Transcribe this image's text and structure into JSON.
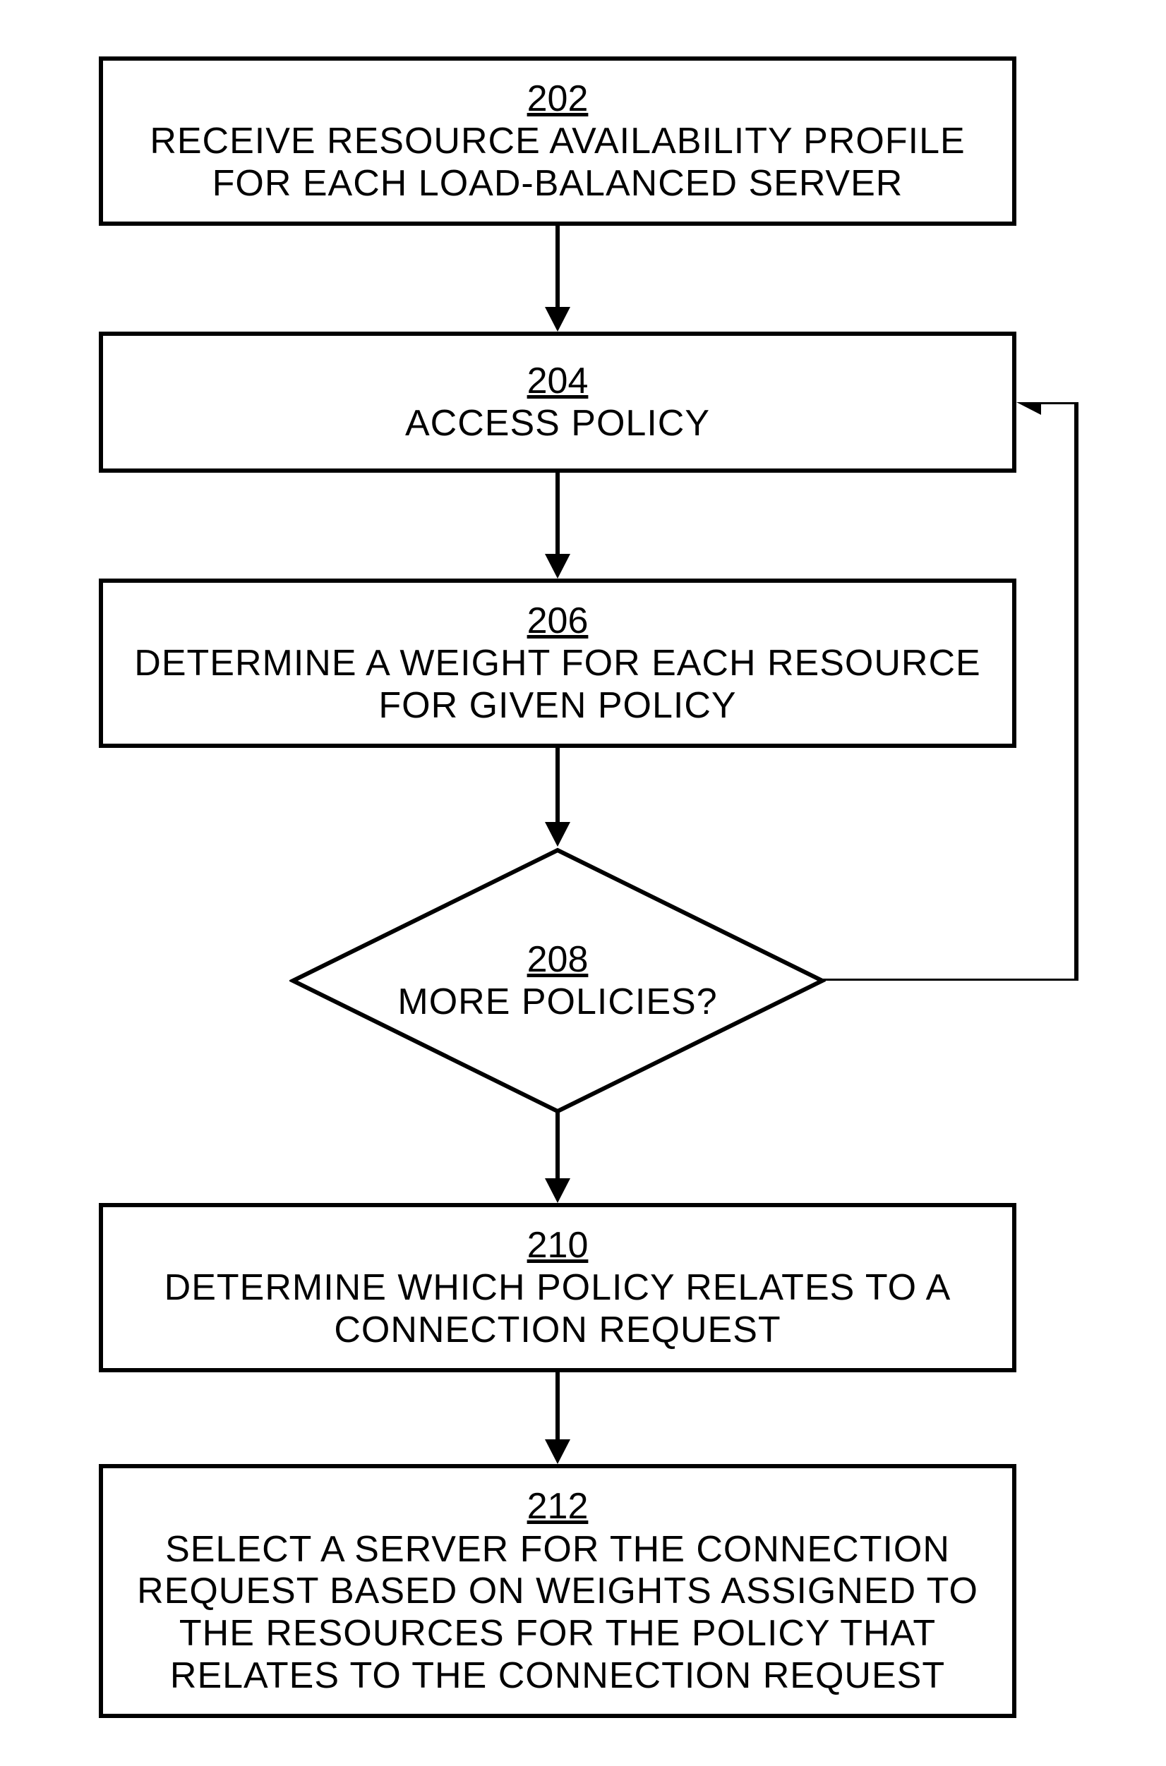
{
  "flowchart": {
    "type": "process-flow",
    "steps": [
      {
        "id": "202",
        "text": "RECEIVE RESOURCE AVAILABILITY PROFILE FOR EACH LOAD-BALANCED SERVER",
        "shape": "rect"
      },
      {
        "id": "204",
        "text": "ACCESS POLICY",
        "shape": "rect"
      },
      {
        "id": "206",
        "text": "DETERMINE A WEIGHT FOR EACH RESOURCE FOR GIVEN POLICY",
        "shape": "rect"
      },
      {
        "id": "208",
        "text": "MORE POLICIES?",
        "shape": "diamond"
      },
      {
        "id": "210",
        "text": "DETERMINE WHICH POLICY RELATES TO A CONNECTION REQUEST",
        "shape": "rect"
      },
      {
        "id": "212",
        "text": "SELECT A SERVER FOR THE CONNECTION REQUEST BASED ON WEIGHTS ASSIGNED TO THE RESOURCES FOR THE POLICY THAT RELATES TO THE CONNECTION REQUEST",
        "shape": "rect"
      }
    ],
    "edges": [
      {
        "from": "202",
        "to": "204"
      },
      {
        "from": "204",
        "to": "206"
      },
      {
        "from": "206",
        "to": "208"
      },
      {
        "from": "208",
        "to": "210",
        "branch": "no"
      },
      {
        "from": "208",
        "to": "204",
        "branch": "yes-loop"
      },
      {
        "from": "210",
        "to": "212"
      }
    ]
  }
}
